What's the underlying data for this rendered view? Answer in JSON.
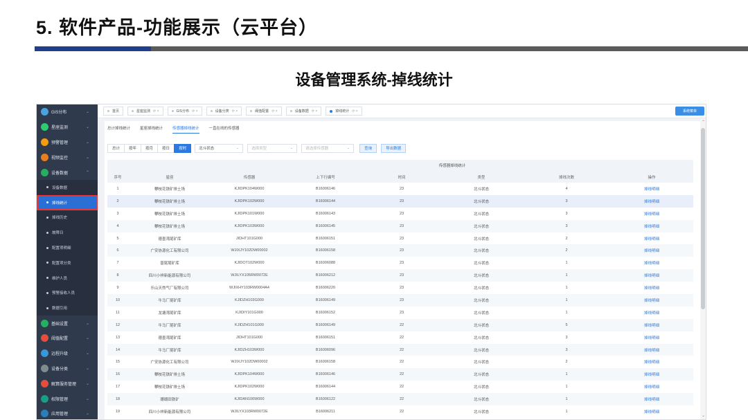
{
  "slide": {
    "title": "5. 软件产品-功能展示（云平台）",
    "subtitle": "设备管理系统-掉线统计"
  },
  "sidebar": {
    "items": [
      {
        "label": "GIS分布",
        "icon_color": "#4aa3df",
        "type": "item"
      },
      {
        "label": "星座监测",
        "icon_color": "#2ecc71",
        "type": "item"
      },
      {
        "label": "预警管理",
        "icon_color": "#f39c12",
        "type": "item"
      },
      {
        "label": "视频监控",
        "icon_color": "#e67e22",
        "type": "item"
      },
      {
        "label": "设备数据",
        "icon_color": "#27ae60",
        "type": "item",
        "expanded": true
      },
      {
        "label": "设备数据",
        "type": "sub"
      },
      {
        "label": "掉线统计",
        "type": "sub",
        "active": true
      },
      {
        "label": "掉线历史",
        "type": "sub"
      },
      {
        "label": "故障日",
        "type": "sub"
      },
      {
        "label": "配置项明细",
        "type": "sub"
      },
      {
        "label": "配置项分类",
        "type": "sub"
      },
      {
        "label": "维护人员",
        "type": "sub"
      },
      {
        "label": "预警接收人员",
        "type": "sub"
      },
      {
        "label": "数据引用",
        "type": "sub"
      },
      {
        "label": "基础设置",
        "icon_color": "#27ae60",
        "type": "item"
      },
      {
        "label": "阈值配置",
        "icon_color": "#e74c3c",
        "type": "item"
      },
      {
        "label": "远程升级",
        "icon_color": "#3498db",
        "type": "item"
      },
      {
        "label": "设备分类",
        "icon_color": "#7f8c8d",
        "type": "item"
      },
      {
        "label": "解算服务管理",
        "icon_color": "#e74c3c",
        "type": "item"
      },
      {
        "label": "权限管理",
        "icon_color": "#16a085",
        "type": "item"
      },
      {
        "label": "应用管理",
        "icon_color": "#2980b9",
        "type": "item"
      }
    ]
  },
  "tabbar": {
    "tabs": [
      {
        "label": "首页",
        "closable": false,
        "active": false
      },
      {
        "label": "星座监测",
        "closable": true,
        "active": false
      },
      {
        "label": "GIS分布",
        "closable": true,
        "active": false
      },
      {
        "label": "设备分类",
        "closable": true,
        "active": false
      },
      {
        "label": "阈值配置",
        "closable": true,
        "active": false
      },
      {
        "label": "设备数据",
        "closable": true,
        "active": false
      },
      {
        "label": "掉线统计",
        "closable": true,
        "active": true
      }
    ],
    "action_label": "系统菜单"
  },
  "subtabs": [
    "总计掉线统计",
    "星座掉线统计",
    "传感器掉线统计",
    "一直在线的传感器"
  ],
  "subtab_active": 2,
  "filters": {
    "segments": [
      "总计",
      "按年",
      "按月",
      "按日",
      "按时"
    ],
    "segment_active": 4,
    "select1": {
      "value": "北斗状态",
      "placeholder": ""
    },
    "select2": {
      "value": "",
      "placeholder": "选择类型"
    },
    "select3": {
      "value": "",
      "placeholder": "请选择传感器"
    },
    "query_label": "查询",
    "export_label": "导出数据"
  },
  "table": {
    "group_header": "传感器掉线统计",
    "columns": [
      "序号",
      "星座",
      "传感器",
      "上下行编号",
      "时间",
      "类型",
      "掉线次数",
      "操作"
    ],
    "rows": [
      [
        "1",
        "攀枝花铁矿排土场",
        "KJIDPK104W000",
        "B16006146",
        "23",
        "北斗状态",
        "4",
        "掉线明细"
      ],
      [
        "2",
        "攀枝花铁矿排土场",
        "KJIDPK102W000",
        "B16006144",
        "23",
        "北斗状态",
        "3",
        "掉线明细"
      ],
      [
        "3",
        "攀枝花铁矿排土场",
        "KJIDPK101W000",
        "B16006143",
        "23",
        "北斗状态",
        "3",
        "掉线明细"
      ],
      [
        "4",
        "攀枝花铁矿排土场",
        "KJIDPK103W000",
        "B16006145",
        "23",
        "北斗状态",
        "3",
        "掉线明细"
      ],
      [
        "5",
        "德墨湾尾矿库",
        "JIDHT101G000",
        "B16006151",
        "23",
        "北斗状态",
        "2",
        "掉线明细"
      ],
      [
        "6",
        "广安协源化工有限公司",
        "WJIXJY102DW00002",
        "B16006158",
        "23",
        "北斗状态",
        "2",
        "掉线明细"
      ],
      [
        "7",
        "普尾尾矿库",
        "KJIDOT102W000",
        "B16006088",
        "23",
        "北斗状态",
        "1",
        "掉线明细"
      ],
      [
        "8",
        "四川小祥新能源有限公司",
        "WJILYX105RW0072E",
        "B16006212",
        "23",
        "北斗状态",
        "1",
        "掉线明细"
      ],
      [
        "9",
        "乐山天然气厂有限公司",
        "WJIXHY103RW0004A4",
        "B16006220",
        "23",
        "北斗状态",
        "1",
        "掉线明细"
      ],
      [
        "10",
        "牛马厂尾矿库",
        "KJIDZH103G000",
        "B16006149",
        "23",
        "北斗状态",
        "1",
        "掉线明细"
      ],
      [
        "11",
        "龙塘湾尾矿库",
        "KJIDIY101G000",
        "B16006152",
        "23",
        "北斗状态",
        "1",
        "掉线明细"
      ],
      [
        "12",
        "牛马厂尾矿库",
        "KJIDZH101G000",
        "B16006149",
        "22",
        "北斗状态",
        "5",
        "掉线明细"
      ],
      [
        "13",
        "德墨湾尾矿库",
        "JIDHT101G000",
        "B16006151",
        "22",
        "北斗状态",
        "3",
        "掉线明细"
      ],
      [
        "14",
        "牛马厂尾矿库",
        "KJIDZH103W000",
        "B16006096",
        "22",
        "北斗状态",
        "3",
        "掉线明细"
      ],
      [
        "15",
        "广安协源化工有限公司",
        "WJIXJY102DW00002",
        "B16006158",
        "22",
        "北斗状态",
        "2",
        "掉线明细"
      ],
      [
        "16",
        "攀枝花铁矿排土场",
        "KJIDPK104W000",
        "B16006146",
        "22",
        "北斗状态",
        "1",
        "掉线明细"
      ],
      [
        "17",
        "攀枝花铁矿排土场",
        "KJIDPK102W000",
        "B16006144",
        "22",
        "北斗状态",
        "1",
        "掉线明细"
      ],
      [
        "18",
        "珊瑚田铁矿",
        "KJIDAN106W000",
        "B16006122",
        "22",
        "北斗状态",
        "1",
        "掉线明细"
      ],
      [
        "19",
        "四川小祥新能源有限公司",
        "WJILYX103RW0072E",
        "B16006211",
        "22",
        "北斗状态",
        "1",
        "掉线明细"
      ]
    ]
  }
}
